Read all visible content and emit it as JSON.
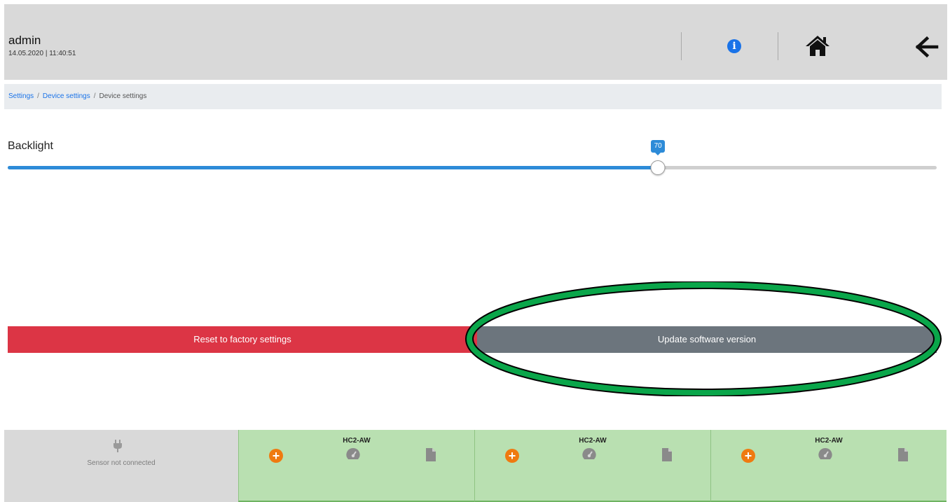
{
  "header": {
    "user": "admin",
    "datetime": "14.05.2020 | 11:40:51",
    "icons": [
      "info-icon",
      "home-icon",
      "back-arrow-icon"
    ]
  },
  "breadcrumb": {
    "items": [
      "Settings",
      "Device settings",
      "Device settings"
    ],
    "separator": "/"
  },
  "backlight": {
    "label": "Backlight",
    "value": "70",
    "min": 0,
    "max": 100
  },
  "actions": {
    "reset_label": "Reset to factory settings",
    "update_label": "Update software version",
    "highlight_color": "#0aa64a"
  },
  "footer": {
    "empty_tile": {
      "status": "Sensor not connected",
      "icon": "plug-icon"
    },
    "tiles": [
      {
        "title": "HC2-AW",
        "icons": [
          "add-icon",
          "gauge-icon",
          "document-icon"
        ]
      },
      {
        "title": "HC2-AW",
        "icons": [
          "add-icon",
          "gauge-icon",
          "document-icon"
        ]
      },
      {
        "title": "HC2-AW",
        "icons": [
          "add-icon",
          "gauge-icon",
          "document-icon"
        ]
      }
    ]
  },
  "colors": {
    "accent": "#2d8bd8",
    "danger": "#dc3545",
    "secondary": "#6c757d",
    "sensor_ok": "#b9e0b1",
    "add_orange": "#ef7a10"
  }
}
